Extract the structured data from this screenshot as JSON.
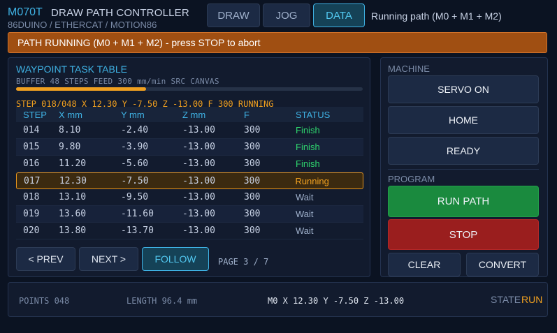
{
  "header": {
    "model": "M070T",
    "title": "DRAW PATH CONTROLLER",
    "subtitle": "86DUINO / ETHERCAT / MOTION86",
    "tabs": [
      {
        "label": "DRAW",
        "active": false
      },
      {
        "label": "JOG",
        "active": false
      },
      {
        "label": "DATA",
        "active": true
      }
    ],
    "run_status": "Running path (M0 + M1 + M2)"
  },
  "banner": {
    "text": "PATH RUNNING (M0 + M1 + M2) - press STOP to abort",
    "color": "#a04f12"
  },
  "task_table": {
    "title": "WAYPOINT TASK TABLE",
    "meta": "BUFFER 48 STEPS FEED 300 mm/min SRC CANVAS",
    "progress_fraction": 0.375,
    "step_line": "STEP 018/048 X 12.30 Y -7.50 Z -13.00 F 300 RUNNING",
    "columns": [
      "STEP",
      "X mm",
      "Y mm",
      "Z mm",
      "F",
      "STATUS"
    ],
    "rows": [
      {
        "step": "014",
        "x": "8.10",
        "y": "-2.40",
        "z": "-13.00",
        "f": "300",
        "status": "Finish",
        "state": "finish"
      },
      {
        "step": "015",
        "x": "9.80",
        "y": "-3.90",
        "z": "-13.00",
        "f": "300",
        "status": "Finish",
        "state": "finish"
      },
      {
        "step": "016",
        "x": "11.20",
        "y": "-5.60",
        "z": "-13.00",
        "f": "300",
        "status": "Finish",
        "state": "finish"
      },
      {
        "step": "017",
        "x": "12.30",
        "y": "-7.50",
        "z": "-13.00",
        "f": "300",
        "status": "Running",
        "state": "running"
      },
      {
        "step": "018",
        "x": "13.10",
        "y": "-9.50",
        "z": "-13.00",
        "f": "300",
        "status": "Wait",
        "state": "wait"
      },
      {
        "step": "019",
        "x": "13.60",
        "y": "-11.60",
        "z": "-13.00",
        "f": "300",
        "status": "Wait",
        "state": "wait"
      },
      {
        "step": "020",
        "x": "13.80",
        "y": "-13.70",
        "z": "-13.00",
        "f": "300",
        "status": "Wait",
        "state": "wait"
      }
    ],
    "prev_label": "< PREV",
    "next_label": "NEXT >",
    "follow_label": "FOLLOW",
    "page_info": "PAGE 3 / 7"
  },
  "machine": {
    "section_label": "MACHINE",
    "servo_on_label": "SERVO ON",
    "home_label": "HOME",
    "ready_label": "READY"
  },
  "program": {
    "section_label": "PROGRAM",
    "run_path_label": "RUN PATH",
    "stop_label": "STOP",
    "clear_label": "CLEAR",
    "convert_label": "CONVERT"
  },
  "footer": {
    "points": "POINTS 048",
    "length": "LENGTH 96.4 mm",
    "position": "M0 X 12.30 Y -7.50 Z -13.00",
    "state_label": "STATE",
    "state_value": "RUN"
  },
  "colors": {
    "accent": "#3fb2e4",
    "warning": "#f0a020",
    "finish": "#2fd66e",
    "run_button": "#1a8a3e",
    "stop_button": "#9a1e1e"
  }
}
